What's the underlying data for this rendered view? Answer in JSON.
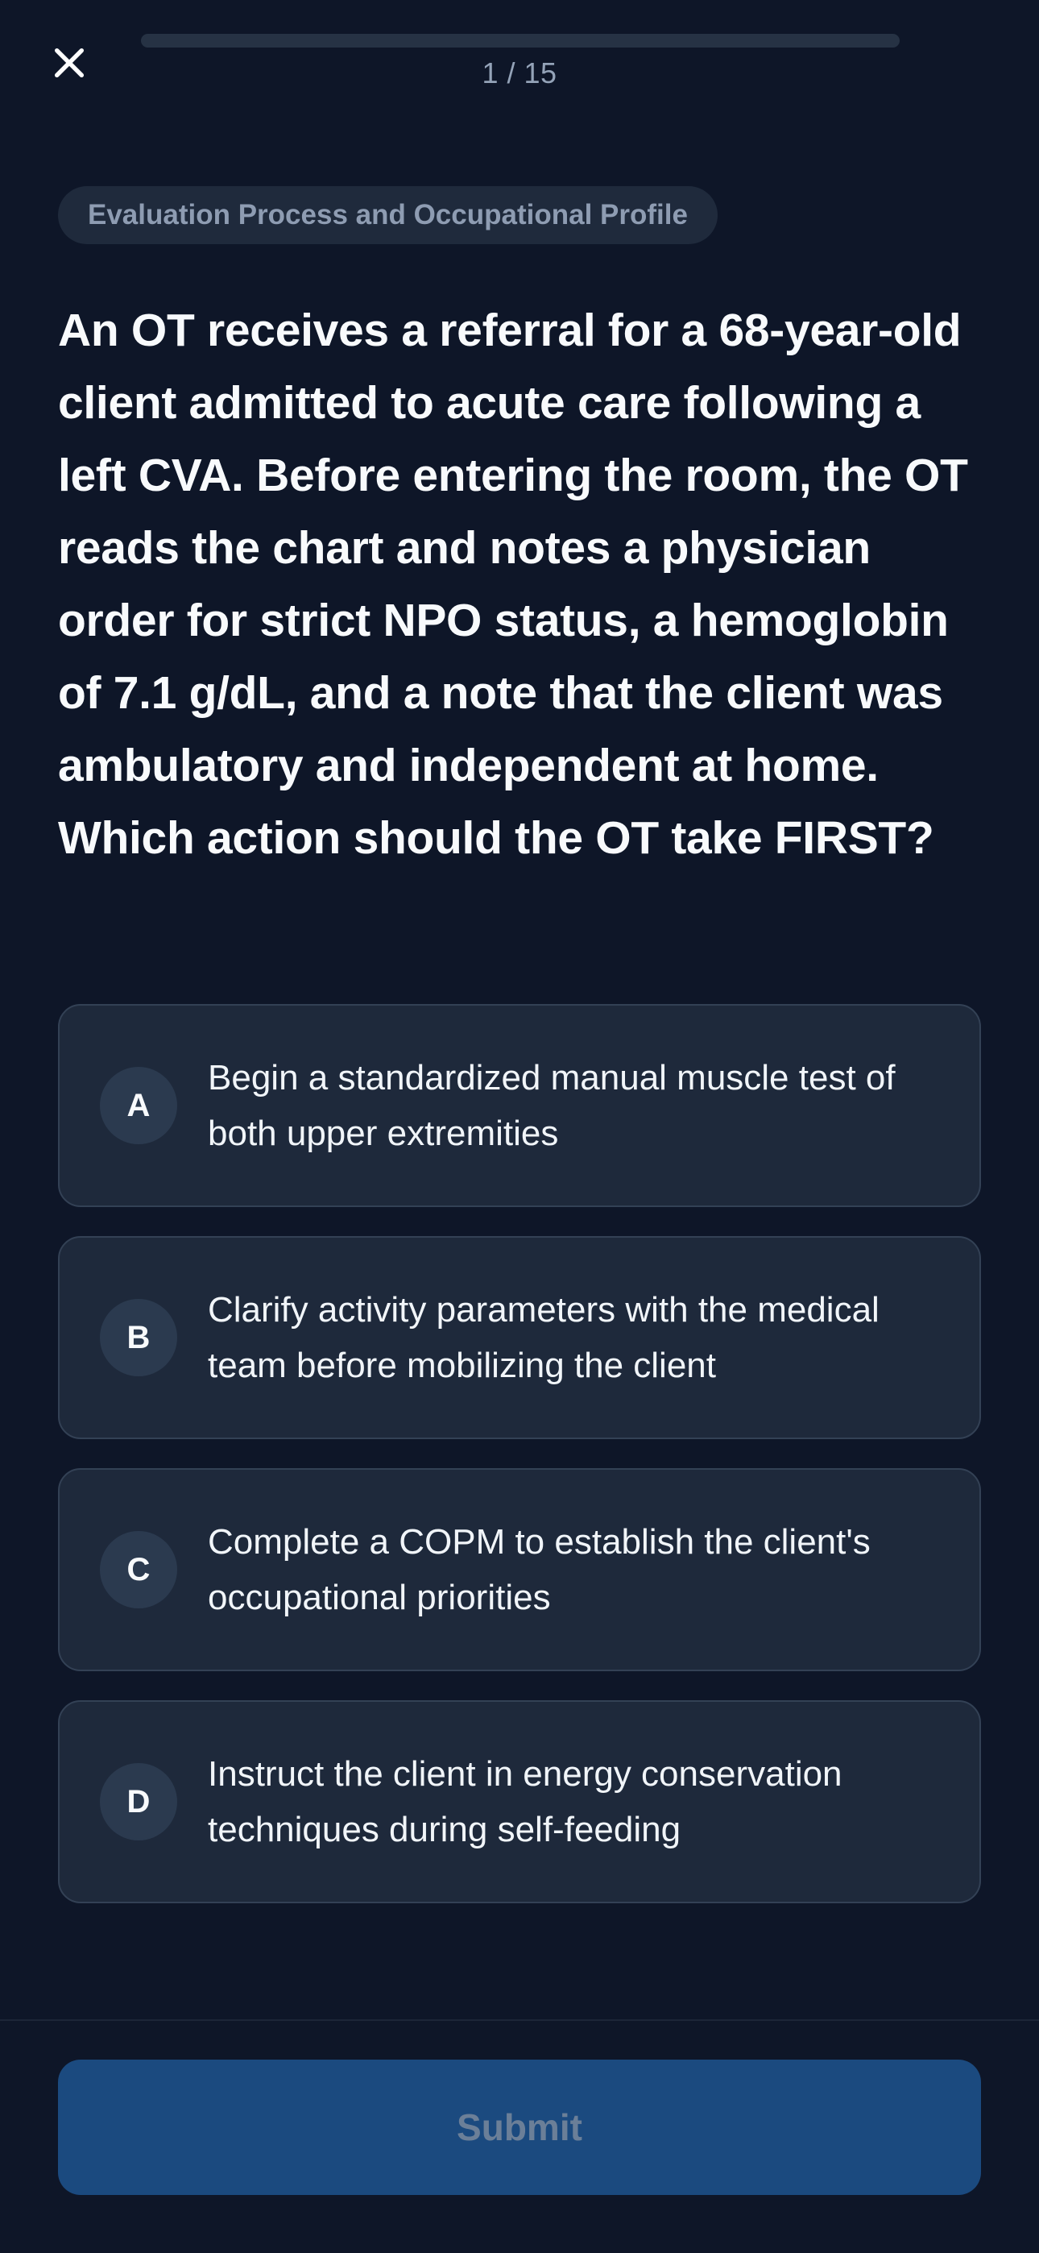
{
  "header": {
    "close_icon": "close-icon",
    "progress_text": "1 / 15",
    "progress_fraction": 0.0
  },
  "question": {
    "category": "Evaluation Process and Occupational Profile",
    "text": "An OT receives a referral for a 68-year-old client admitted to acute care following a left CVA. Before entering the room, the OT reads the chart and notes a physician order for strict NPO status, a hemoglobin of 7.1 g/dL, and a note that the client was ambulatory and independent at home. Which action should the OT take FIRST?"
  },
  "options": [
    {
      "letter": "A",
      "text": "Begin a standardized manual muscle test of both upper extremities"
    },
    {
      "letter": "B",
      "text": "Clarify activity parameters with the medical team before mobilizing the client"
    },
    {
      "letter": "C",
      "text": "Complete a COPM to establish the client's occupational priorities"
    },
    {
      "letter": "D",
      "text": "Instruct the client in energy conservation techniques during self-feeding"
    }
  ],
  "footer": {
    "submit_label": "Submit"
  },
  "colors": {
    "background": "#0e1628",
    "card": "#1e293b",
    "card_border": "#334155",
    "submit_bg": "#1b4a7f",
    "submit_text": "#6b7f98"
  }
}
